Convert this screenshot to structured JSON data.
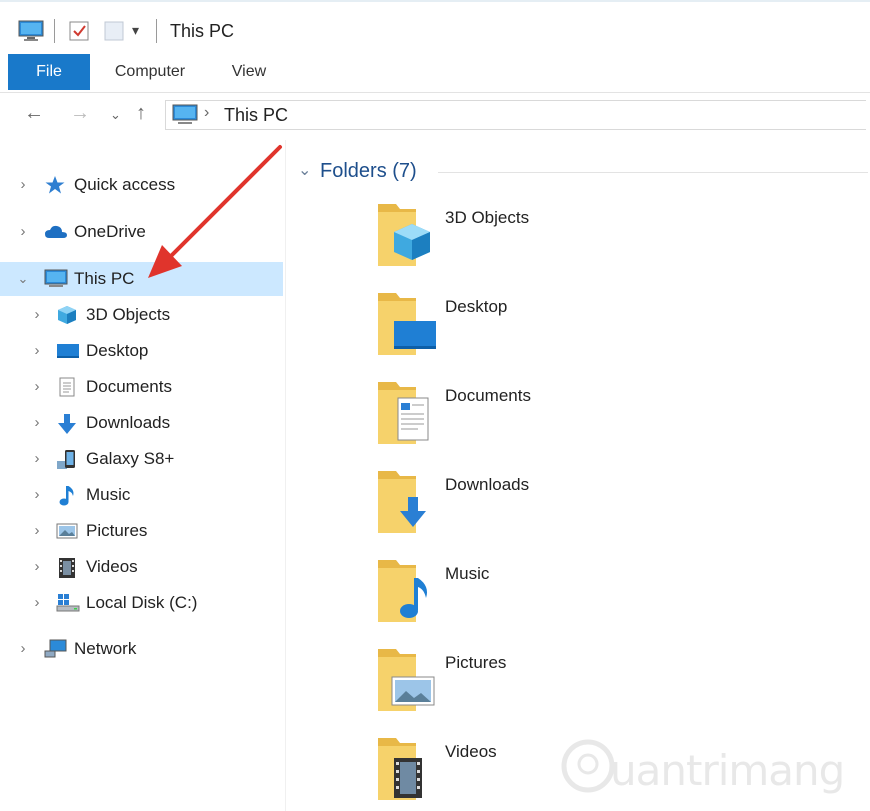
{
  "window": {
    "title": "This PC"
  },
  "ribbon": {
    "tabs": [
      "File",
      "Computer",
      "View"
    ]
  },
  "address": {
    "path": "This PC"
  },
  "sidebar": {
    "items": [
      {
        "label": "Quick access",
        "icon": "star-pin-icon"
      },
      {
        "label": "OneDrive",
        "icon": "cloud-icon"
      },
      {
        "label": "This PC",
        "icon": "computer-icon",
        "selected": true,
        "expanded": true
      },
      {
        "label": "3D Objects",
        "icon": "cube-icon"
      },
      {
        "label": "Desktop",
        "icon": "desktop-icon"
      },
      {
        "label": "Documents",
        "icon": "document-icon"
      },
      {
        "label": "Downloads",
        "icon": "download-arrow-icon"
      },
      {
        "label": "Galaxy S8+",
        "icon": "phone-icon"
      },
      {
        "label": "Music",
        "icon": "music-note-icon"
      },
      {
        "label": "Pictures",
        "icon": "picture-icon"
      },
      {
        "label": "Videos",
        "icon": "film-icon"
      },
      {
        "label": "Local Disk (C:)",
        "icon": "drive-icon"
      },
      {
        "label": "Network",
        "icon": "network-icon"
      }
    ]
  },
  "content": {
    "group_title": "Folders (7)",
    "folders": [
      {
        "label": "3D Objects",
        "overlay": "cube"
      },
      {
        "label": "Desktop",
        "overlay": "desktop"
      },
      {
        "label": "Documents",
        "overlay": "document"
      },
      {
        "label": "Downloads",
        "overlay": "download"
      },
      {
        "label": "Music",
        "overlay": "music"
      },
      {
        "label": "Pictures",
        "overlay": "picture"
      },
      {
        "label": "Videos",
        "overlay": "film"
      }
    ]
  },
  "annotation": {
    "color": "#e0342c"
  },
  "watermark": {
    "text": "uantrimang"
  },
  "colors": {
    "accent": "#1979ca",
    "selection": "#cce8ff",
    "folder": "#f4c95d"
  }
}
